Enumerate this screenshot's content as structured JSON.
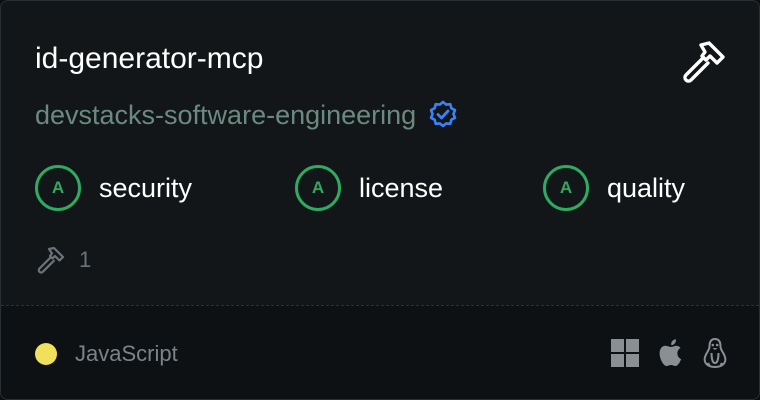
{
  "card": {
    "title": "id-generator-mcp",
    "owner": "devstacks-software-engineering",
    "verified": true,
    "grades": [
      {
        "letter": "A",
        "label": "security"
      },
      {
        "letter": "A",
        "label": "license"
      },
      {
        "letter": "A",
        "label": "quality"
      }
    ],
    "tools_count": "1",
    "language": {
      "name": "JavaScript",
      "color": "#f1e05a"
    },
    "platforms": [
      "windows-icon",
      "apple-icon",
      "linux-icon"
    ],
    "colors": {
      "grade_green": "#2eab61",
      "verified_blue": "#3b82f6",
      "owner_text": "#6b8a7f"
    }
  }
}
